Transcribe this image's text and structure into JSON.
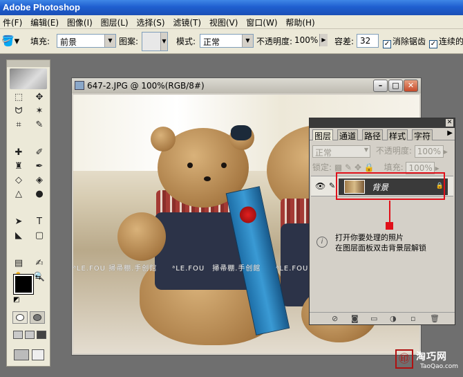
{
  "app": {
    "title": "Adobe Photoshop"
  },
  "menu": [
    "件(F)",
    "编辑(E)",
    "图像(I)",
    "图层(L)",
    "选择(S)",
    "滤镜(T)",
    "视图(V)",
    "窗口(W)",
    "帮助(H)"
  ],
  "options": {
    "fill_label": "填充:",
    "fill_value": "前景",
    "pattern_label": "图案:",
    "mode_label": "模式:",
    "mode_value": "正常",
    "opacity_label": "不透明度:",
    "opacity_value": "100%",
    "tolerance_label": "容差:",
    "tolerance_value": "32",
    "antialias_label": "消除锯齿",
    "contiguous_label": "连续的"
  },
  "document": {
    "title": "647-2.JPG @ 100%(RGB/8#)"
  },
  "watermark": "ᵃLE.FOU 掃帚棚.手创館　　ᵃLE.FOU　掃帚棚.手创館　　ᵃLE.FOU　掃帚棚.手创館　　ᵃLE.FOU",
  "layers_panel": {
    "tabs": [
      "图层",
      "通道",
      "路径",
      "样式",
      "字符"
    ],
    "blend_value": "正常",
    "opacity_label": "不透明度:",
    "opacity_value": "100%",
    "lock_label": "锁定:",
    "fill_label": "填充:",
    "fill_value": "100%",
    "layer_name": "背景"
  },
  "note": {
    "line1": "打开你要处理的照片",
    "line2": "在图层面板双击背景层解锁"
  },
  "logo": {
    "text": "淘巧网",
    "sub": "TaoQao.com"
  },
  "colors": {
    "accent": "#e0101a",
    "titlebar": "#1f5fd0"
  }
}
